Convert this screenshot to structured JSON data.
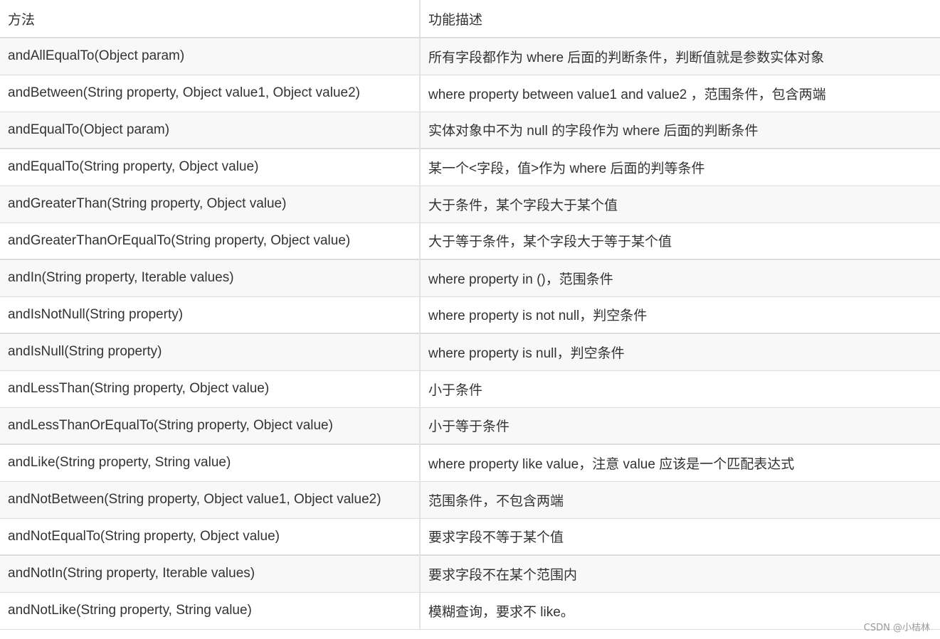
{
  "table": {
    "headers": [
      "方法",
      "功能描述"
    ],
    "rows": [
      {
        "method": "andAllEqualTo(Object param)",
        "description": "所有字段都作为 where 后面的判断条件，判断值就是参数实体对象"
      },
      {
        "method": "andBetween(String property, Object value1, Object value2)",
        "description": "where property between value1 and value2 ，范围条件，包含两端"
      },
      {
        "method": "andEqualTo(Object param)",
        "description": "实体对象中不为 null 的字段作为 where 后面的判断条件"
      },
      {
        "method": "andEqualTo(String property, Object value)",
        "description": "某一个<字段，值>作为 where 后面的判等条件"
      },
      {
        "method": "andGreaterThan(String property, Object value)",
        "description": "大于条件，某个字段大于某个值"
      },
      {
        "method": "andGreaterThanOrEqualTo(String property, Object value)",
        "description": "大于等于条件，某个字段大于等于某个值"
      },
      {
        "method": "andIn(String property, Iterable values)",
        "description": "where property in ()，范围条件"
      },
      {
        "method": "andIsNotNull(String property)",
        "description": "where property is not null，判空条件"
      },
      {
        "method": "andIsNull(String property)",
        "description": "where property is null，判空条件"
      },
      {
        "method": "andLessThan(String property, Object value)",
        "description": "小于条件"
      },
      {
        "method": "andLessThanOrEqualTo(String property, Object value)",
        "description": "小于等于条件"
      },
      {
        "method": "andLike(String property, String value)",
        "description": "where property like value，注意 value 应该是一个匹配表达式"
      },
      {
        "method": "andNotBetween(String property, Object value1, Object value2)",
        "description": "范围条件，不包含两端"
      },
      {
        "method": "andNotEqualTo(String property, Object value)",
        "description": "要求字段不等于某个值"
      },
      {
        "method": "andNotIn(String property, Iterable values)",
        "description": "要求字段不在某个范围内"
      },
      {
        "method": "andNotLike(String property, String value)",
        "description": "模糊查询，要求不 like。"
      }
    ]
  },
  "watermark": "CSDN @小桔林"
}
